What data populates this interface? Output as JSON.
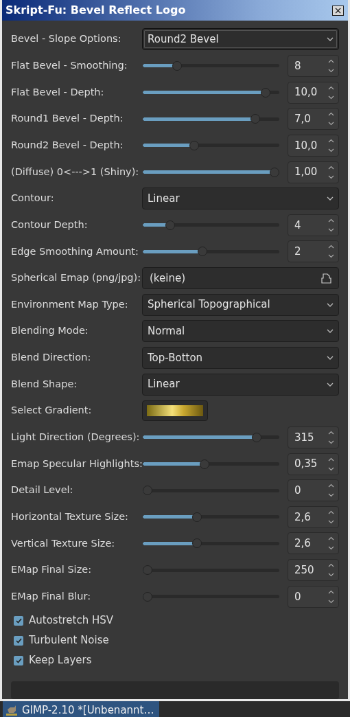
{
  "window": {
    "title": "Skript-Fu: Bevel Reflect Logo",
    "close": "×"
  },
  "fields": [
    {
      "kind": "select",
      "label": "Bevel - Slope Options:",
      "value": "Round2 Bevel",
      "focused": true
    },
    {
      "kind": "slider",
      "label": "Flat Bevel - Smoothing:",
      "level": 0.23,
      "value": "8"
    },
    {
      "kind": "slider",
      "label": "Flat Bevel - Depth:",
      "level": 0.93,
      "value": "10,0"
    },
    {
      "kind": "slider",
      "label": "Round1 Bevel - Depth:",
      "level": 0.85,
      "value": "7,0"
    },
    {
      "kind": "slider",
      "label": "Round2 Bevel - Depth:",
      "level": 0.37,
      "value": "10,0"
    },
    {
      "kind": "slider",
      "label": "(Diffuse) 0<--->1 (Shiny):",
      "level": 1,
      "value": "1,00"
    },
    {
      "kind": "select",
      "label": "Contour:",
      "value": "Linear",
      "focused": false
    },
    {
      "kind": "slider",
      "label": "Contour Depth:",
      "level": 0.18,
      "value": "4"
    },
    {
      "kind": "slider",
      "label": "Edge Smoothing Amount:",
      "level": 0.43,
      "value": "2"
    },
    {
      "kind": "file",
      "label": "Spherical Emap (png/jpg):",
      "value": "(keine)"
    },
    {
      "kind": "select",
      "label": "Environment Map Type:",
      "value": "Spherical Topographical",
      "focused": false
    },
    {
      "kind": "select",
      "label": "Blending Mode:",
      "value": "Normal",
      "focused": false
    },
    {
      "kind": "select",
      "label": "Blend Direction:",
      "value": "Top-Botton",
      "focused": false
    },
    {
      "kind": "select",
      "label": "Blend Shape:",
      "value": "Linear",
      "focused": false
    },
    {
      "kind": "gradient",
      "label": "Select Gradient:"
    },
    {
      "kind": "slider",
      "label": "Light Direction (Degrees):",
      "level": 0.86,
      "value": "315"
    },
    {
      "kind": "slider",
      "label": "Emap Specular Highlights:",
      "level": 0.45,
      "value": "0,35"
    },
    {
      "kind": "slider",
      "label": "Detail Level:",
      "level": 0,
      "value": "0"
    },
    {
      "kind": "slider",
      "label": "Horizontal Texture Size:",
      "level": 0.39,
      "value": "2,6"
    },
    {
      "kind": "slider",
      "label": "Vertical Texture Size:",
      "level": 0.39,
      "value": "2,6"
    },
    {
      "kind": "slider",
      "label": "EMap Final Size:",
      "level": 0,
      "value": "250"
    },
    {
      "kind": "slider",
      "label": "EMap Final Blur:",
      "level": 0,
      "value": "0"
    }
  ],
  "checkboxes": [
    {
      "label": "Autostretch HSV",
      "checked": true
    },
    {
      "label": "Turbulent Noise",
      "checked": true
    },
    {
      "label": "Keep Layers",
      "checked": true
    }
  ],
  "progress": {
    "level": 0
  },
  "taskbar": {
    "label": "GIMP-2.10 *[Unbenannt…"
  }
}
